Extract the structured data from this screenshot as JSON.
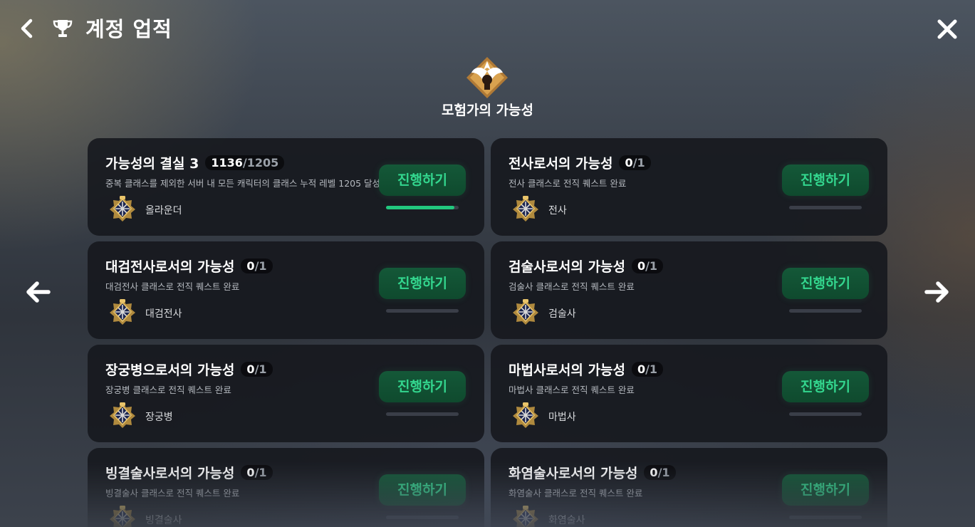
{
  "header": {
    "title": "계정 업적",
    "back_icon": "back-chevron-icon",
    "trophy_icon": "trophy-icon",
    "close_icon": "close-icon"
  },
  "category": {
    "title": "모험가의 가능성",
    "emblem_icon": "winged-emblem-icon"
  },
  "nav": {
    "prev_icon": "arrow-left-icon",
    "next_icon": "arrow-right-icon"
  },
  "colors": {
    "accent_green": "#22c77e",
    "button_text": "#33d68e",
    "button_bg": "#145838",
    "card_bg": "#16181e"
  },
  "achievements": [
    {
      "title": "가능성의 결실 3",
      "current": "1136",
      "sep": "/",
      "total": "1205",
      "desc": "중복 클래스를 제외한 서버 내 모든 캐릭터의 클래스 누적 레벨 1205 달성",
      "reward": "올라운더",
      "button": "진행하기",
      "progress": 0.943
    },
    {
      "title": "전사로서의 가능성",
      "current": "0",
      "sep": "/",
      "total": "1",
      "desc": "전사 클래스로 전직 퀘스트 완료",
      "reward": "전사",
      "button": "진행하기",
      "progress": 0
    },
    {
      "title": "대검전사로서의 가능성",
      "current": "0",
      "sep": "/",
      "total": "1",
      "desc": "대검전사 클래스로 전직 퀘스트 완료",
      "reward": "대검전사",
      "button": "진행하기",
      "progress": 0
    },
    {
      "title": "검술사로서의 가능성",
      "current": "0",
      "sep": "/",
      "total": "1",
      "desc": "검술사 클래스로 전직 퀘스트 완료",
      "reward": "검술사",
      "button": "진행하기",
      "progress": 0
    },
    {
      "title": "장궁병으로서의 가능성",
      "current": "0",
      "sep": "/",
      "total": "1",
      "desc": "장궁병 클래스로 전직 퀘스트 완료",
      "reward": "장궁병",
      "button": "진행하기",
      "progress": 0
    },
    {
      "title": "마법사로서의 가능성",
      "current": "0",
      "sep": "/",
      "total": "1",
      "desc": "마법사 클래스로 전직 퀘스트 완료",
      "reward": "마법사",
      "button": "진행하기",
      "progress": 0
    },
    {
      "title": "빙결술사로서의 가능성",
      "current": "0",
      "sep": "/",
      "total": "1",
      "desc": "빙결술사 클래스로 전직 퀘스트 완료",
      "reward": "빙결술사",
      "button": "진행하기",
      "progress": 0
    },
    {
      "title": "화염술사로서의 가능성",
      "current": "0",
      "sep": "/",
      "total": "1",
      "desc": "화염술사 클래스로 전직 퀘스트 완료",
      "reward": "화염술사",
      "button": "진행하기",
      "progress": 0
    }
  ]
}
